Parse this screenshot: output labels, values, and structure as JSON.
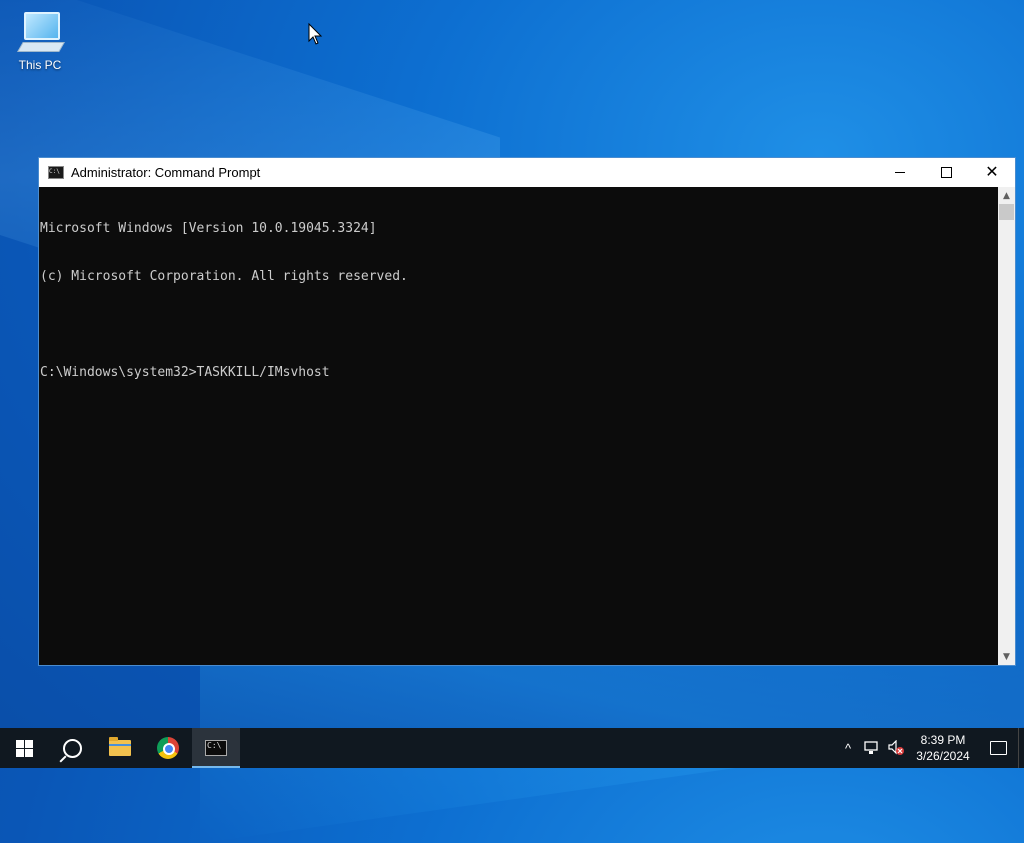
{
  "desktop": {
    "icons": [
      {
        "label": "This PC",
        "icon": "this-pc-icon"
      }
    ]
  },
  "window": {
    "title": "Administrator: Command Prompt",
    "icon": "command-prompt-icon",
    "controls": {
      "minimize": "minimize-icon",
      "maximize": "maximize-icon",
      "close": "close-icon"
    }
  },
  "console": {
    "lines": [
      "Microsoft Windows [Version 10.0.19045.3324]",
      "(c) Microsoft Corporation. All rights reserved.",
      "",
      "C:\\Windows\\system32>TASKKILL/IMsvhost"
    ]
  },
  "taskbar": {
    "items": [
      {
        "name": "start-button",
        "icon": "windows-logo-icon"
      },
      {
        "name": "search-button",
        "icon": "search-icon"
      },
      {
        "name": "file-explorer",
        "icon": "folder-icon"
      },
      {
        "name": "google-chrome",
        "icon": "chrome-icon"
      },
      {
        "name": "command-prompt",
        "icon": "command-prompt-icon",
        "active": true
      }
    ],
    "tray": {
      "chevron": "^",
      "time": "8:39 PM",
      "date": "3/26/2024"
    }
  }
}
